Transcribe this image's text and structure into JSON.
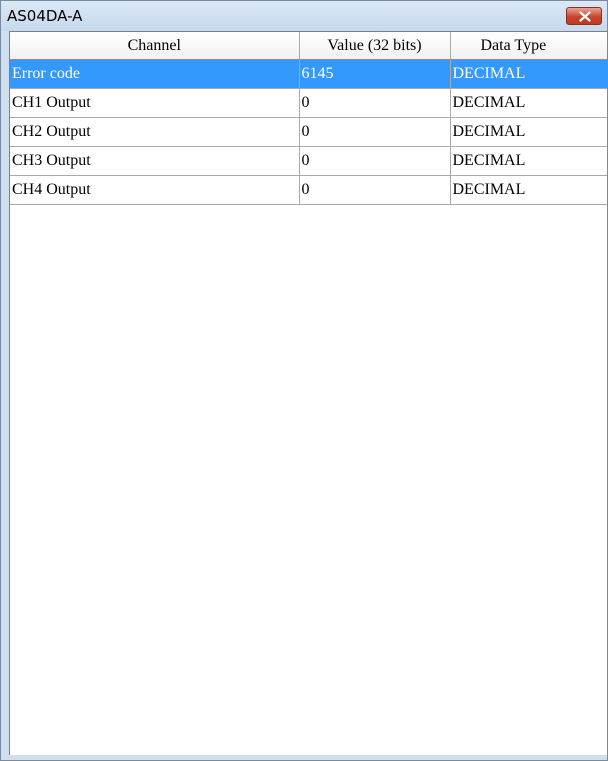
{
  "window": {
    "title": "AS04DA-A",
    "close_icon": "close-x-icon",
    "close_color": "#c9452d"
  },
  "grid": {
    "columns": [
      "Channel",
      "Value (32 bits)",
      "Data Type"
    ],
    "rows": [
      {
        "channel": "Error code",
        "value": "6145",
        "type": "DECIMAL",
        "selected": true
      },
      {
        "channel": "CH1 Output",
        "value": "0",
        "type": "DECIMAL",
        "selected": false
      },
      {
        "channel": "CH2 Output",
        "value": "0",
        "type": "DECIMAL",
        "selected": false
      },
      {
        "channel": "CH3 Output",
        "value": "0",
        "type": "DECIMAL",
        "selected": false
      },
      {
        "channel": "CH4 Output",
        "value": "0",
        "type": "DECIMAL",
        "selected": false
      }
    ],
    "selection_color": "#3399ff"
  }
}
